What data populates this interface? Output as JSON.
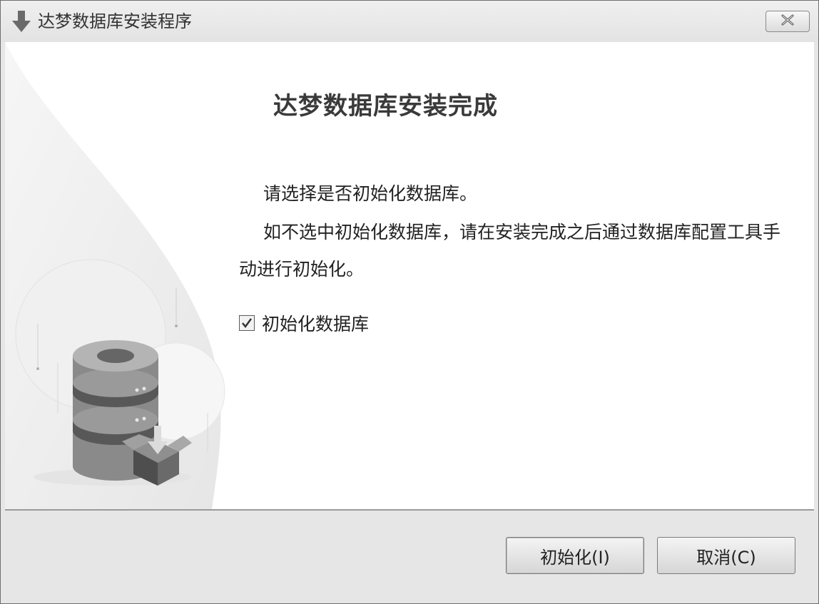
{
  "window": {
    "title": "达梦数据库安装程序"
  },
  "main": {
    "heading": "达梦数据库安装完成",
    "paragraph1": "请选择是否初始化数据库。",
    "paragraph2_line1": "如不选中初始化数据库，请在安装完成之后通过数据库配置工具手",
    "paragraph2_line2": "动进行初始化。",
    "checkbox": {
      "label": "初始化数据库",
      "checked": true
    }
  },
  "buttons": {
    "init_label": "初始化(I)",
    "cancel_label": "取消(C)"
  },
  "icons": {
    "title": "download-arrow-icon",
    "close": "close-icon",
    "illustration": "database-install-illustration"
  }
}
